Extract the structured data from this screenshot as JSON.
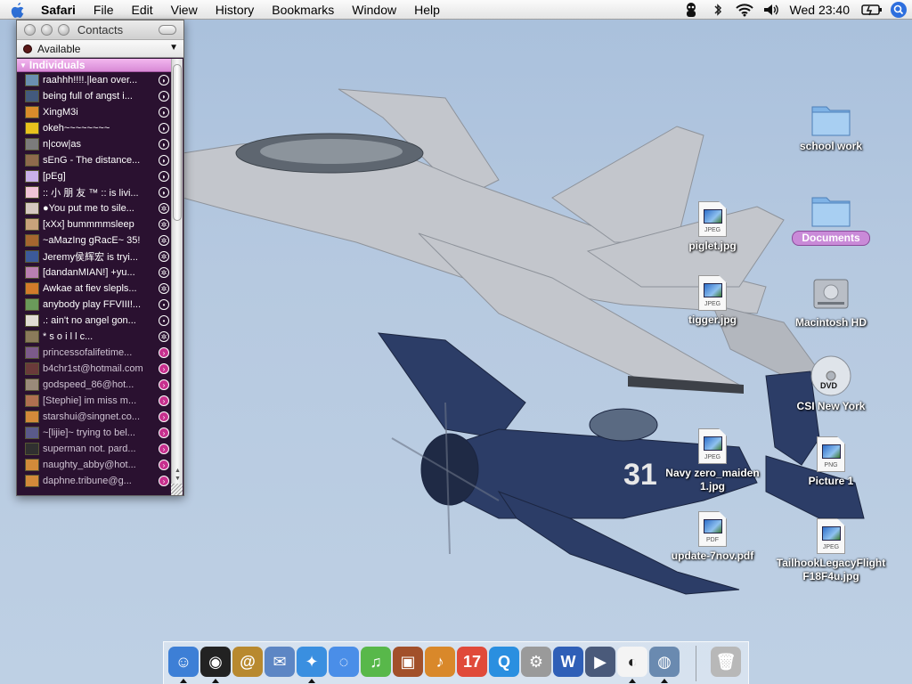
{
  "menubar": {
    "apple": "apple-icon",
    "app_name": "Safari",
    "menus": [
      "File",
      "Edit",
      "View",
      "History",
      "Bookmarks",
      "Window",
      "Help"
    ],
    "status_icons": [
      "ichat-buddy-icon",
      "bluetooth-icon",
      "wifi-icon",
      "volume-icon"
    ],
    "clock": "Wed 23:40",
    "battery": "battery-icon",
    "spotlight": "spotlight-search-icon"
  },
  "contacts_window": {
    "title": "Contacts",
    "status": "Available",
    "group": "Individuals",
    "buddies": [
      {
        "name": "raahhh!!!!.|lean over...",
        "state": "online",
        "color": "#6a8fb0"
      },
      {
        "name": "being full of angst i...",
        "state": "online",
        "color": "#435a7d"
      },
      {
        "name": "XingM3i",
        "state": "online",
        "color": "#d98c2b"
      },
      {
        "name": "okeh~~~~~~~~",
        "state": "online",
        "color": "#e8c21d"
      },
      {
        "name": "n|cow|as",
        "state": "online",
        "color": "#7b7b7b"
      },
      {
        "name": "sEnG - The distance...",
        "state": "online",
        "color": "#8e6a4c"
      },
      {
        "name": "[pEg]",
        "state": "online",
        "color": "#c9b0e8"
      },
      {
        "name": ":: 小 朋 友 ™ :: is livi...",
        "state": "online",
        "color": "#f1c4d7"
      },
      {
        "name": "●You put me to sile...",
        "state": "idle-dot",
        "color": "#d5c8c0"
      },
      {
        "name": "[xXx] bummmmsleep",
        "state": "idle-dot",
        "color": "#c8a37b"
      },
      {
        "name": "~aMazIng gRacE~ 35!",
        "state": "idle-dot",
        "color": "#a5662f"
      },
      {
        "name": "Jeremy侯辉宏 is tryi...",
        "state": "idle-dot",
        "color": "#3c5a9a"
      },
      {
        "name": "[dandanMIAN!] +yu...",
        "state": "idle-dot",
        "color": "#b97fb0"
      },
      {
        "name": "Awkae at fiev slepls...",
        "state": "idle-dot",
        "color": "#d27b2a"
      },
      {
        "name": "anybody play FFVIII!...",
        "state": "away-dot",
        "color": "#6a9a5a"
      },
      {
        "name": ".: ain't no angel gon...",
        "state": "away-dot",
        "color": "#e1dcd3"
      },
      {
        "name": "*          s o i l l c...",
        "state": "idle-dot",
        "color": "#8a7a5a"
      },
      {
        "name": "princessofalifetime...",
        "state": "idle",
        "color": "#7b5a8a"
      },
      {
        "name": "b4chr1st@hotmail.com",
        "state": "idle",
        "color": "#6a3a3a"
      },
      {
        "name": "godspeed_86@hot...",
        "state": "idle",
        "color": "#9a8a7a"
      },
      {
        "name": "[Stephie] im miss m...",
        "state": "idle",
        "color": "#b07050"
      },
      {
        "name": "starshui@singnet.co...",
        "state": "idle",
        "color": "#d28a3a"
      },
      {
        "name": "~[lijie]~ trying to bel...",
        "state": "idle",
        "color": "#5a5a8a"
      },
      {
        "name": "superman not. pard...",
        "state": "idle",
        "color": "#303030"
      },
      {
        "name": "naughty_abby@hot...",
        "state": "idle",
        "color": "#d28a3a"
      },
      {
        "name": "daphne.tribune@g...",
        "state": "idle",
        "color": "#d28a3a"
      }
    ]
  },
  "desktop_icons": [
    {
      "label": "school work",
      "kind": "folder-icon"
    },
    {
      "label": "Documents",
      "kind": "folder-icon"
    },
    {
      "label": "Macintosh HD",
      "kind": "hard-drive-icon"
    },
    {
      "label": "CSI New York",
      "kind": "dvd-icon"
    },
    {
      "label": "Picture 1",
      "kind": "png-file-icon",
      "ftype": "PNG"
    },
    {
      "label": "TailhookLegacyFlight F18F4u.jpg",
      "kind": "jpeg-file-icon",
      "ftype": "JPEG"
    },
    {
      "label": "piglet.jpg",
      "kind": "jpeg-file-icon",
      "ftype": "JPEG"
    },
    {
      "label": "tigger.jpg",
      "kind": "jpeg-file-icon",
      "ftype": "JPEG"
    },
    {
      "label": "Navy zero_maiden 1.jpg",
      "kind": "jpeg-file-icon",
      "ftype": "JPEG"
    },
    {
      "label": "update-7nov.pdf",
      "kind": "pdf-file-icon",
      "ftype": "PDF"
    }
  ],
  "dock": {
    "items": [
      {
        "name": "finder-icon",
        "glyph": "☺",
        "color": "#3d7fd6",
        "running": true
      },
      {
        "name": "dashboard-icon",
        "glyph": "◉",
        "color": "#222222",
        "running": true
      },
      {
        "name": "address-book-icon",
        "glyph": "@",
        "color": "#b8892f",
        "running": false
      },
      {
        "name": "mail-icon",
        "glyph": "✉",
        "color": "#5d86c4",
        "running": false
      },
      {
        "name": "safari-icon",
        "glyph": "✦",
        "color": "#3a8fe0",
        "running": true
      },
      {
        "name": "ichat-icon",
        "glyph": "◌",
        "color": "#4a8ee8",
        "running": false
      },
      {
        "name": "itunes-icon",
        "glyph": "♫",
        "color": "#58b84a",
        "running": false
      },
      {
        "name": "iphoto-icon",
        "glyph": "▣",
        "color": "#a2502a",
        "running": false
      },
      {
        "name": "garageband-icon",
        "glyph": "♪",
        "color": "#d9882a",
        "running": false
      },
      {
        "name": "ical-icon",
        "glyph": "17",
        "color": "#e04a3a",
        "running": false
      },
      {
        "name": "quicktime-icon",
        "glyph": "Q",
        "color": "#2a8fe0",
        "running": false
      },
      {
        "name": "system-preferences-icon",
        "glyph": "⚙",
        "color": "#9a9a9a",
        "running": false
      },
      {
        "name": "word-icon",
        "glyph": "W",
        "color": "#2f5fb7",
        "running": false
      },
      {
        "name": "imovie-icon",
        "glyph": "▶",
        "color": "#4a5a7a",
        "running": false
      },
      {
        "name": "adium-icon",
        "glyph": "◐",
        "color": "#f4f4f4",
        "running": true
      },
      {
        "name": "preview-icon",
        "glyph": "◍",
        "color": "#6a8ab0",
        "running": true
      }
    ],
    "trash": {
      "name": "trash-icon",
      "glyph": "🗑",
      "color": "#b8b8b8"
    }
  }
}
